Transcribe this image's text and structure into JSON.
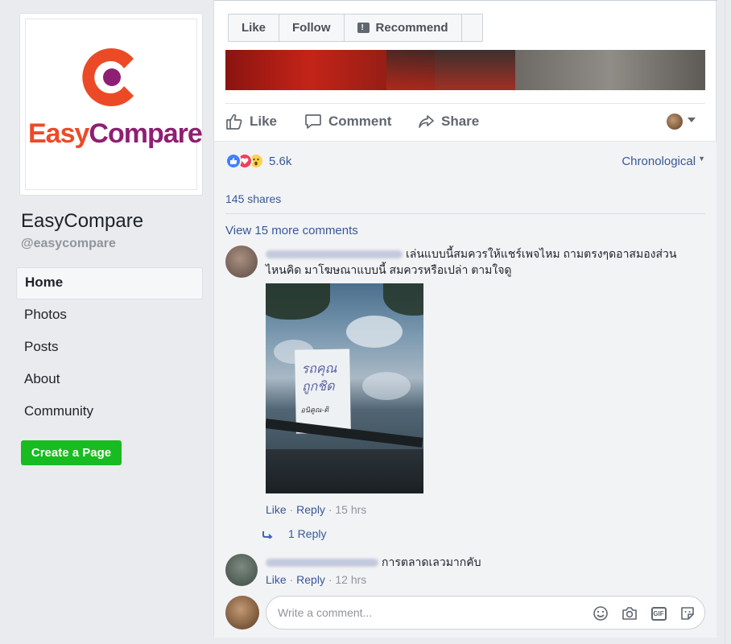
{
  "brand": {
    "logo_word_first": "Easy",
    "logo_word_second": "Compare",
    "accent_orange": "#ec4a27",
    "accent_purple": "#8e1f73"
  },
  "page": {
    "name": "EasyCompare",
    "handle": "@easycompare"
  },
  "sidebar": {
    "items": [
      {
        "label": "Home",
        "active": true
      },
      {
        "label": "Photos",
        "active": false
      },
      {
        "label": "Posts",
        "active": false
      },
      {
        "label": "About",
        "active": false
      },
      {
        "label": "Community",
        "active": false
      }
    ],
    "create_page": "Create a Page"
  },
  "page_buttons": {
    "like": "Like",
    "follow": "Follow",
    "recommend": "Recommend"
  },
  "post_actions": {
    "like": "Like",
    "comment": "Comment",
    "share": "Share"
  },
  "reactions": {
    "count": "5.6k",
    "types": [
      "like-icon",
      "love-icon",
      "wow-icon"
    ]
  },
  "comment_sort": "Chronological",
  "shares": "145 shares",
  "more_comments": "View 15 more comments",
  "comments": [
    {
      "text_line1": "เล่นแบบนี้สมควรให้แชร์เพจไหม ถามตรงๆดอาสมองส่วน",
      "text_line2": "ไหนคิด มาโฆษณาแบบนี้ สมควรหรือเปล่า ตามใจดู",
      "photo_note_line1": "รถคุณ",
      "photo_note_line2": "ถูกชิด",
      "photo_note_line3": "อนิคูณ-ดิ",
      "like": "Like",
      "reply": "Reply",
      "time": "15 hrs",
      "replies": "1 Reply"
    },
    {
      "text": "การตลาดเลวมากคับ",
      "like": "Like",
      "reply": "Reply",
      "time": "12 hrs"
    }
  ],
  "composer": {
    "placeholder": "Write a comment..."
  }
}
